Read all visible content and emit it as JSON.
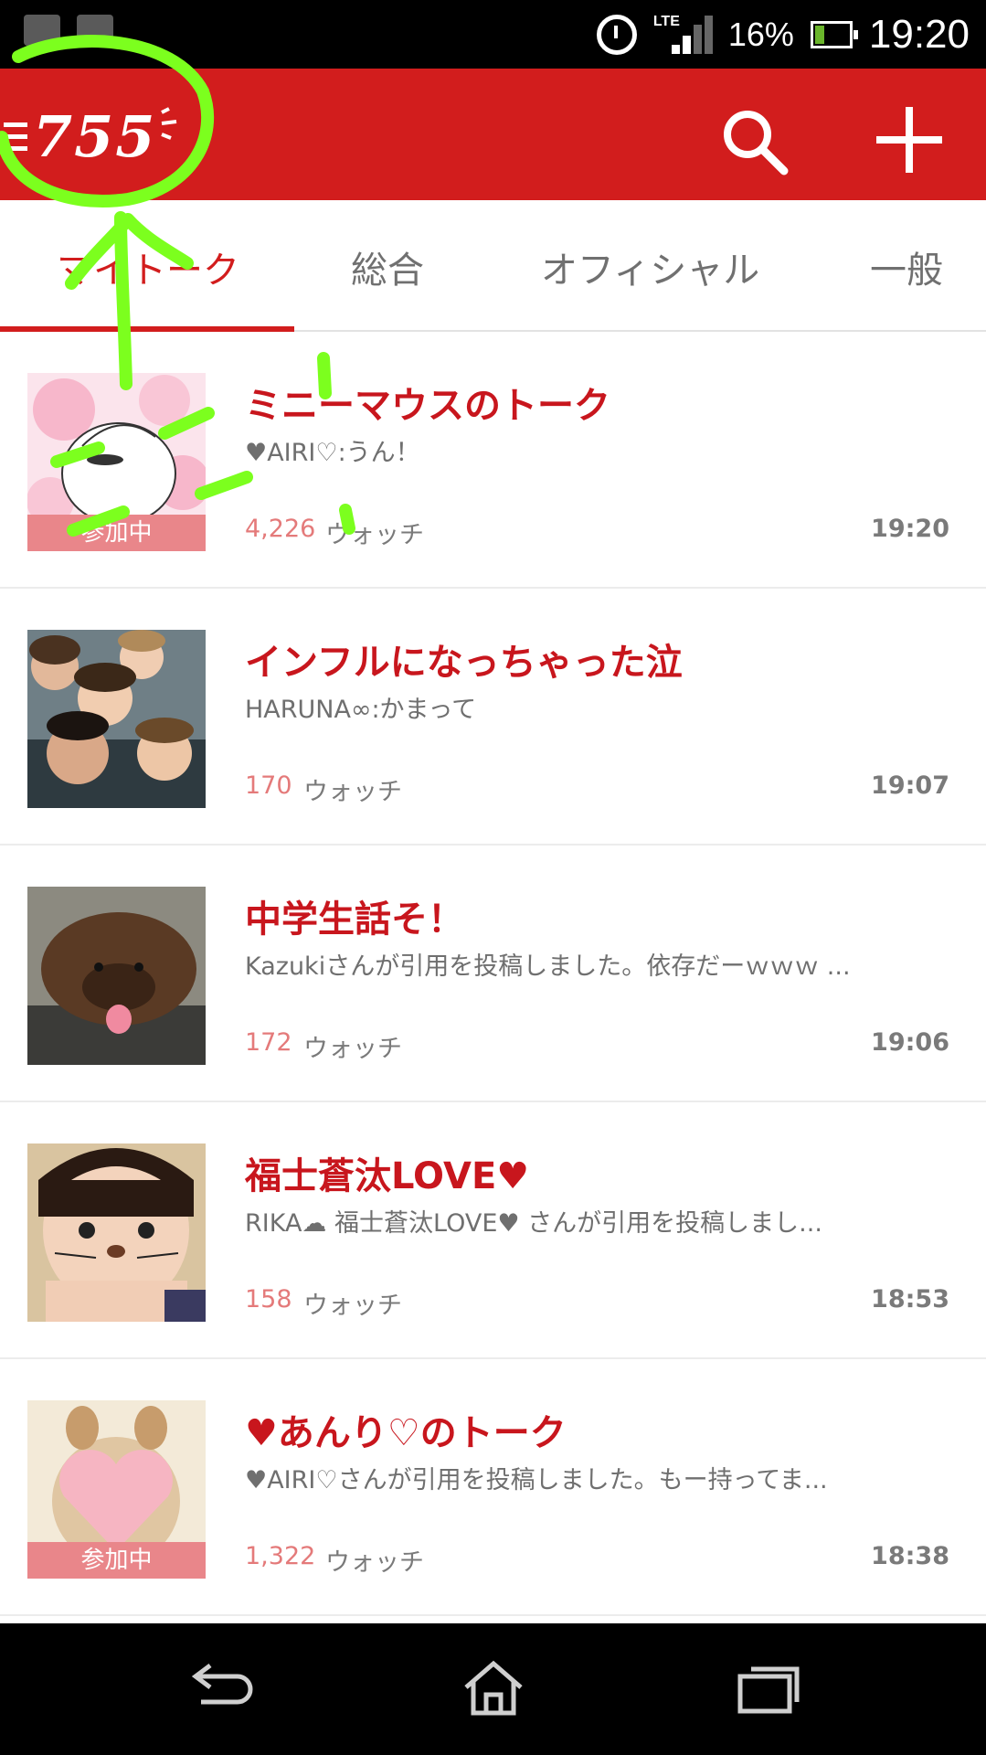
{
  "status_bar": {
    "network": "LTE",
    "battery_percent": "16%",
    "time": "19:20",
    "icons": [
      "notification-icon",
      "alarm-icon",
      "signal-icon",
      "battery-icon"
    ]
  },
  "app_bar": {
    "logo_text": "755",
    "icons": [
      "menu-icon",
      "search-icon",
      "plus-icon"
    ],
    "accent_color": "#d21d1d"
  },
  "tabs": [
    {
      "label": "マイトーク",
      "active": true
    },
    {
      "label": "総合",
      "active": false
    },
    {
      "label": "オフィシャル",
      "active": false
    },
    {
      "label": "一般",
      "active": false
    }
  ],
  "watch_label": "ウォッチ",
  "rows": [
    {
      "title": "ミニーマウスのトーク",
      "preview": "♥AIRI♡:うん！",
      "count": "4,226",
      "watch": "ウォッチ",
      "time": "19:20",
      "badge": "参加中"
    },
    {
      "title": "インフルになっちゃった泣",
      "preview": "HARUNA∞:かまって",
      "count": "170",
      "watch": "ウォッチ",
      "time": "19:07",
      "badge": ""
    },
    {
      "title": "中学生話そ！",
      "preview": "Kazukiさんが引用を投稿しました。依存だーｗｗｗ ...",
      "count": "172",
      "watch": "ウォッチ",
      "time": "19:06",
      "badge": ""
    },
    {
      "title": "福士蒼汰LOVE",
      "title_suffix": "♥",
      "preview": "RIKA☁ 福士蒼汰LOVE♥ さんが引用を投稿しまし...",
      "count": "158",
      "watch": "ウォッチ",
      "time": "18:53",
      "badge": ""
    },
    {
      "title_prefix": "♥",
      "title": "あんり♡のトーク",
      "preview": "♥AIRI♡さんが引用を投稿しました。もー持ってま...",
      "count": "1,322",
      "watch": "ウォッチ",
      "time": "18:38",
      "badge": "参加中"
    }
  ],
  "nav_bar": {
    "icons": [
      "back-icon",
      "home-icon",
      "recent-apps-icon"
    ]
  },
  "annotation": {
    "color": "#7cff1e",
    "description_icon": "hand-drawn-circle-arrow"
  }
}
